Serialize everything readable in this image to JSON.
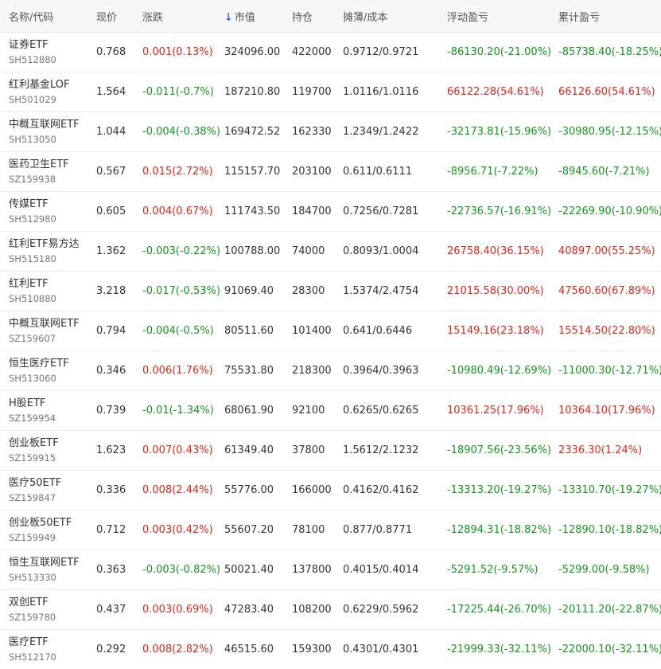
{
  "colors": {
    "up": "#e0251b",
    "down": "#14951f",
    "sort": "#2b6cd4"
  },
  "headers": {
    "name": "名称/代码",
    "price": "现价",
    "change": "涨跌",
    "value": "市值",
    "value_sort_icon": "arrow-down-icon",
    "value_sort_glyph": "↓",
    "position": "持仓",
    "cost": "摊薄/成本",
    "float_pl": "浮动盈亏",
    "total_pl": "累计盈亏"
  },
  "rows": [
    {
      "name": "证券ETF",
      "code": "SH512880",
      "price": "0.768",
      "change": "0.001(0.13%)",
      "change_dir": "up",
      "value": "324096.00",
      "position": "422000",
      "cost": "0.9712/0.9721",
      "float_pl": "-86130.20(-21.00%)",
      "float_dir": "down",
      "total_pl": "-85738.40(-18.25%)",
      "total_dir": "down"
    },
    {
      "name": "红利基金LOF",
      "code": "SH501029",
      "price": "1.564",
      "change": "-0.011(-0.7%)",
      "change_dir": "down",
      "value": "187210.80",
      "position": "119700",
      "cost": "1.0116/1.0116",
      "float_pl": "66122.28(54.61%)",
      "float_dir": "up",
      "total_pl": "66126.60(54.61%)",
      "total_dir": "up"
    },
    {
      "name": "中概互联网ETF",
      "code": "SH513050",
      "price": "1.044",
      "change": "-0.004(-0.38%)",
      "change_dir": "down",
      "value": "169472.52",
      "position": "162330",
      "cost": "1.2349/1.2422",
      "float_pl": "-32173.81(-15.96%)",
      "float_dir": "down",
      "total_pl": "-30980.95(-12.15%)",
      "total_dir": "down"
    },
    {
      "name": "医药卫生ETF",
      "code": "SZ159938",
      "price": "0.567",
      "change": "0.015(2.72%)",
      "change_dir": "up",
      "value": "115157.70",
      "position": "203100",
      "cost": "0.611/0.6111",
      "float_pl": "-8956.71(-7.22%)",
      "float_dir": "down",
      "total_pl": "-8945.60(-7.21%)",
      "total_dir": "down"
    },
    {
      "name": "传媒ETF",
      "code": "SH512980",
      "price": "0.605",
      "change": "0.004(0.67%)",
      "change_dir": "up",
      "value": "111743.50",
      "position": "184700",
      "cost": "0.7256/0.7281",
      "float_pl": "-22736.57(-16.91%)",
      "float_dir": "down",
      "total_pl": "-22269.90(-10.90%)",
      "total_dir": "down"
    },
    {
      "name": "红利ETF易方达",
      "code": "SH515180",
      "price": "1.362",
      "change": "-0.003(-0.22%)",
      "change_dir": "down",
      "value": "100788.00",
      "position": "74000",
      "cost": "0.8093/1.0004",
      "float_pl": "26758.40(36.15%)",
      "float_dir": "up",
      "total_pl": "40897.00(55.25%)",
      "total_dir": "up"
    },
    {
      "name": "红利ETF",
      "code": "SH510880",
      "price": "3.218",
      "change": "-0.017(-0.53%)",
      "change_dir": "down",
      "value": "91069.40",
      "position": "28300",
      "cost": "1.5374/2.4754",
      "float_pl": "21015.58(30.00%)",
      "float_dir": "up",
      "total_pl": "47560.60(67.89%)",
      "total_dir": "up"
    },
    {
      "name": "中概互联网ETF",
      "code": "SZ159607",
      "price": "0.794",
      "change": "-0.004(-0.5%)",
      "change_dir": "down",
      "value": "80511.60",
      "position": "101400",
      "cost": "0.641/0.6446",
      "float_pl": "15149.16(23.18%)",
      "float_dir": "up",
      "total_pl": "15514.50(22.80%)",
      "total_dir": "up"
    },
    {
      "name": "恒生医疗ETF",
      "code": "SH513060",
      "price": "0.346",
      "change": "0.006(1.76%)",
      "change_dir": "up",
      "value": "75531.80",
      "position": "218300",
      "cost": "0.3964/0.3963",
      "float_pl": "-10980.49(-12.69%)",
      "float_dir": "down",
      "total_pl": "-11000.30(-12.71%)",
      "total_dir": "down"
    },
    {
      "name": "H股ETF",
      "code": "SZ159954",
      "price": "0.739",
      "change": "-0.01(-1.34%)",
      "change_dir": "down",
      "value": "68061.90",
      "position": "92100",
      "cost": "0.6265/0.6265",
      "float_pl": "10361.25(17.96%)",
      "float_dir": "up",
      "total_pl": "10364.10(17.96%)",
      "total_dir": "up"
    },
    {
      "name": "创业板ETF",
      "code": "SZ159915",
      "price": "1.623",
      "change": "0.007(0.43%)",
      "change_dir": "up",
      "value": "61349.40",
      "position": "37800",
      "cost": "1.5612/2.1232",
      "float_pl": "-18907.56(-23.56%)",
      "float_dir": "down",
      "total_pl": "2336.30(1.24%)",
      "total_dir": "up"
    },
    {
      "name": "医疗50ETF",
      "code": "SZ159847",
      "price": "0.336",
      "change": "0.008(2.44%)",
      "change_dir": "up",
      "value": "55776.00",
      "position": "166000",
      "cost": "0.4162/0.4162",
      "float_pl": "-13313.20(-19.27%)",
      "float_dir": "down",
      "total_pl": "-13310.70(-19.27%)",
      "total_dir": "down"
    },
    {
      "name": "创业板50ETF",
      "code": "SZ159949",
      "price": "0.712",
      "change": "0.003(0.42%)",
      "change_dir": "up",
      "value": "55607.20",
      "position": "78100",
      "cost": "0.877/0.8771",
      "float_pl": "-12894.31(-18.82%)",
      "float_dir": "down",
      "total_pl": "-12890.10(-18.82%)",
      "total_dir": "down"
    },
    {
      "name": "恒生互联网ETF",
      "code": "SH513330",
      "price": "0.363",
      "change": "-0.003(-0.82%)",
      "change_dir": "down",
      "value": "50021.40",
      "position": "137800",
      "cost": "0.4015/0.4014",
      "float_pl": "-5291.52(-9.57%)",
      "float_dir": "down",
      "total_pl": "-5299.00(-9.58%)",
      "total_dir": "down"
    },
    {
      "name": "双创ETF",
      "code": "SZ159780",
      "price": "0.437",
      "change": "0.003(0.69%)",
      "change_dir": "up",
      "value": "47283.40",
      "position": "108200",
      "cost": "0.6229/0.5962",
      "float_pl": "-17225.44(-26.70%)",
      "float_dir": "down",
      "total_pl": "-20111.20(-22.87%)",
      "total_dir": "down"
    },
    {
      "name": "医疗ETF",
      "code": "SH512170",
      "price": "0.292",
      "change": "0.008(2.82%)",
      "change_dir": "up",
      "value": "46515.60",
      "position": "159300",
      "cost": "0.4301/0.4301",
      "float_pl": "-21999.33(-32.11%)",
      "float_dir": "down",
      "total_pl": "-22000.10(-32.11%)",
      "total_dir": "down"
    }
  ]
}
